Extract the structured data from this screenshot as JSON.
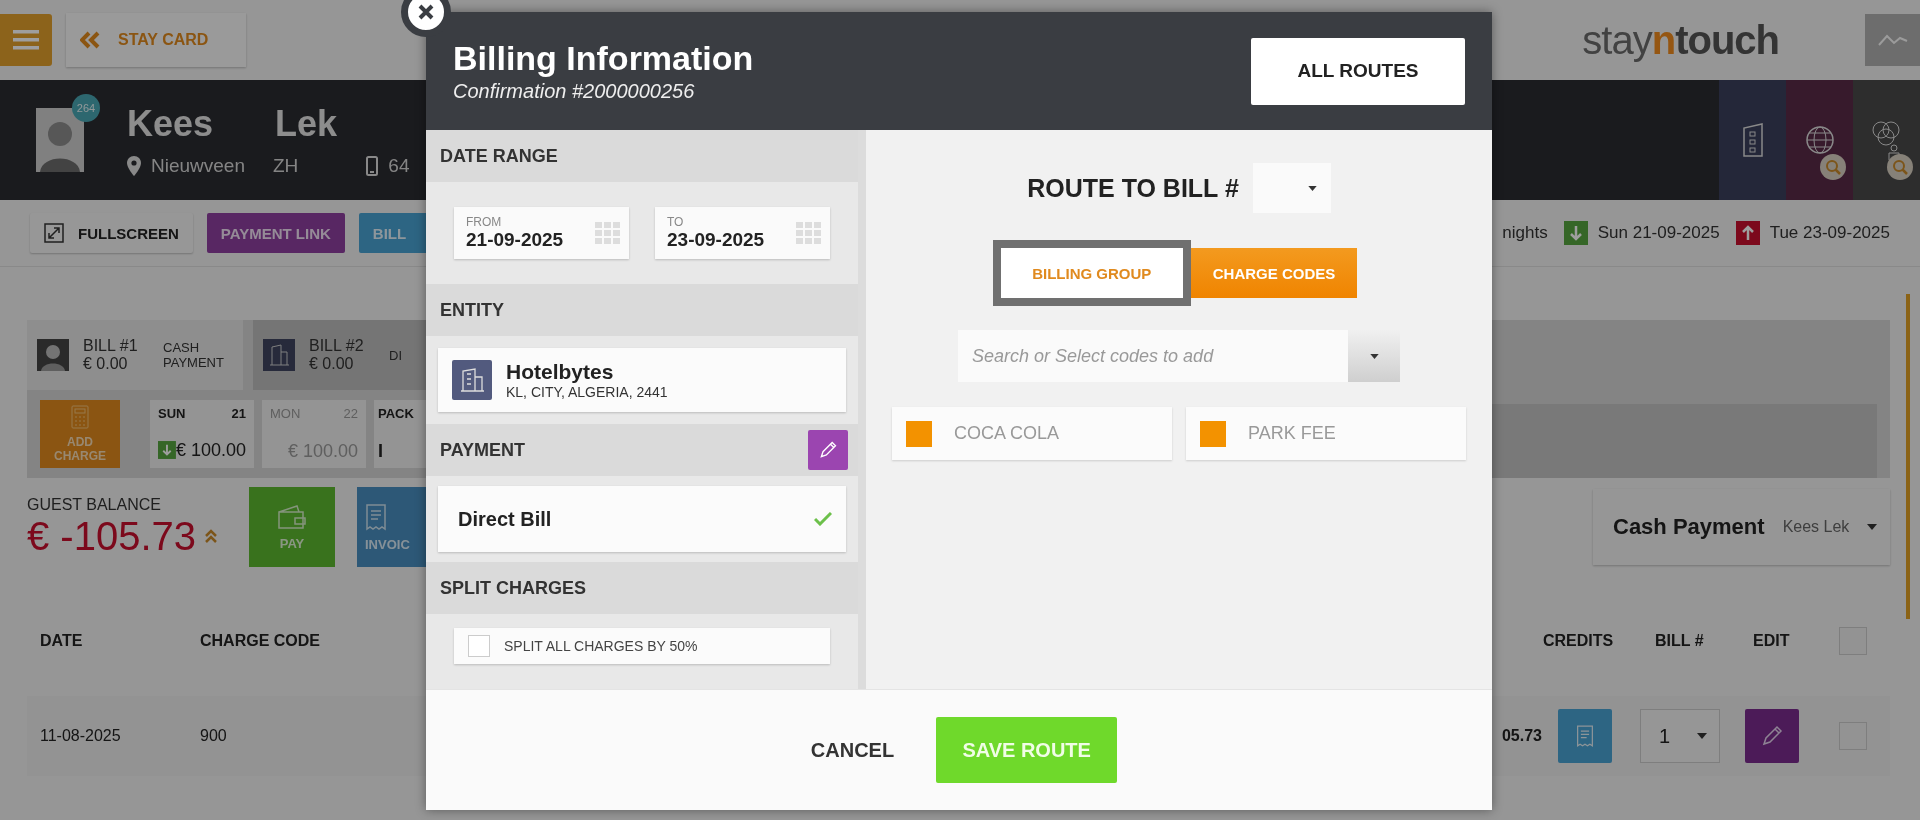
{
  "top_bar": {
    "back_label": "STAY CARD",
    "logo": {
      "start": "stay",
      "accent": "n",
      "end": "touch"
    }
  },
  "guest": {
    "first_name": "Kees",
    "last_name": "Lek",
    "badge": "264",
    "city": "Nieuwveen",
    "region": "ZH",
    "phone": "64"
  },
  "actions": [
    {
      "label": "FULLSCREEN",
      "kind": "fullscreen"
    },
    {
      "label": "PAYMENT LINK",
      "kind": "purple"
    },
    {
      "label": "BILL",
      "kind": "blue"
    }
  ],
  "stay": {
    "nights": "nights",
    "arrival": "Sun 21-09-2025",
    "departure": "Tue 23-09-2025"
  },
  "bills": [
    {
      "label": "BILL #1",
      "amount": "€ 0.00",
      "type": "CASH PAYMENT",
      "kind": "guest",
      "selected": true
    },
    {
      "label": "BILL #2",
      "amount": "€ 0.00",
      "type": "DI",
      "kind": "company",
      "selected": false
    }
  ],
  "add_charge": "ADD CHARGE",
  "days": [
    {
      "kind": "day",
      "day": "SUN",
      "date": "21",
      "amount": "€ 100.00",
      "arrival": true,
      "dimmed": false
    },
    {
      "kind": "day",
      "day": "MON",
      "date": "22",
      "amount": "€ 100.00",
      "arrival": false,
      "dimmed": true
    },
    {
      "kind": "package",
      "day": "PACK",
      "amount": "I"
    }
  ],
  "balance": {
    "label": "GUEST BALANCE",
    "amount": "€ -105.73"
  },
  "balance_buttons": [
    {
      "label": "PAY",
      "kind": "pay"
    },
    {
      "label": "INVOIC",
      "kind": "invoice"
    }
  ],
  "payment_selector": {
    "method": "Cash Payment",
    "guest": "Kees Lek"
  },
  "table": {
    "all_checked": false,
    "columns_left": [
      "DATE",
      "CHARGE CODE"
    ],
    "columns_right": [
      "CREDITS",
      "BILL #",
      "EDIT"
    ],
    "rows": [
      {
        "date": "11-08-2025",
        "charge_code": "900",
        "credits": "05.73",
        "bill": "1",
        "checked": false
      }
    ]
  },
  "modal": {
    "title": "Billing Information",
    "subtitle": "Confirmation #2000000256",
    "all_routes": "ALL ROUTES",
    "date_range": {
      "heading": "DATE RANGE",
      "from_label": "FROM",
      "from": "21-09-2025",
      "to_label": "TO",
      "to": "23-09-2025"
    },
    "entity": {
      "heading": "ENTITY",
      "name": "Hotelbytes",
      "address": "KL, CITY, ALGERIA, 2441"
    },
    "payment": {
      "heading": "PAYMENT",
      "method": "Direct Bill",
      "confirmed": true
    },
    "split": {
      "heading": "SPLIT CHARGES",
      "option": "SPLIT ALL CHARGES BY 50%",
      "checked": false
    },
    "route_label": "ROUTE TO BILL #",
    "toggle": [
      {
        "label": "BILLING GROUP",
        "selected": false,
        "focused": true
      },
      {
        "label": "CHARGE CODES",
        "selected": true,
        "focused": false
      }
    ],
    "search": {
      "placeholder": "Search or Select codes to add"
    },
    "charge_codes": [
      {
        "label": "COCA COLA",
        "color": "#f39200"
      },
      {
        "label": "PARK FEE",
        "color": "#f39200"
      }
    ],
    "cancel": "CANCEL",
    "save": "SAVE ROUTE"
  }
}
